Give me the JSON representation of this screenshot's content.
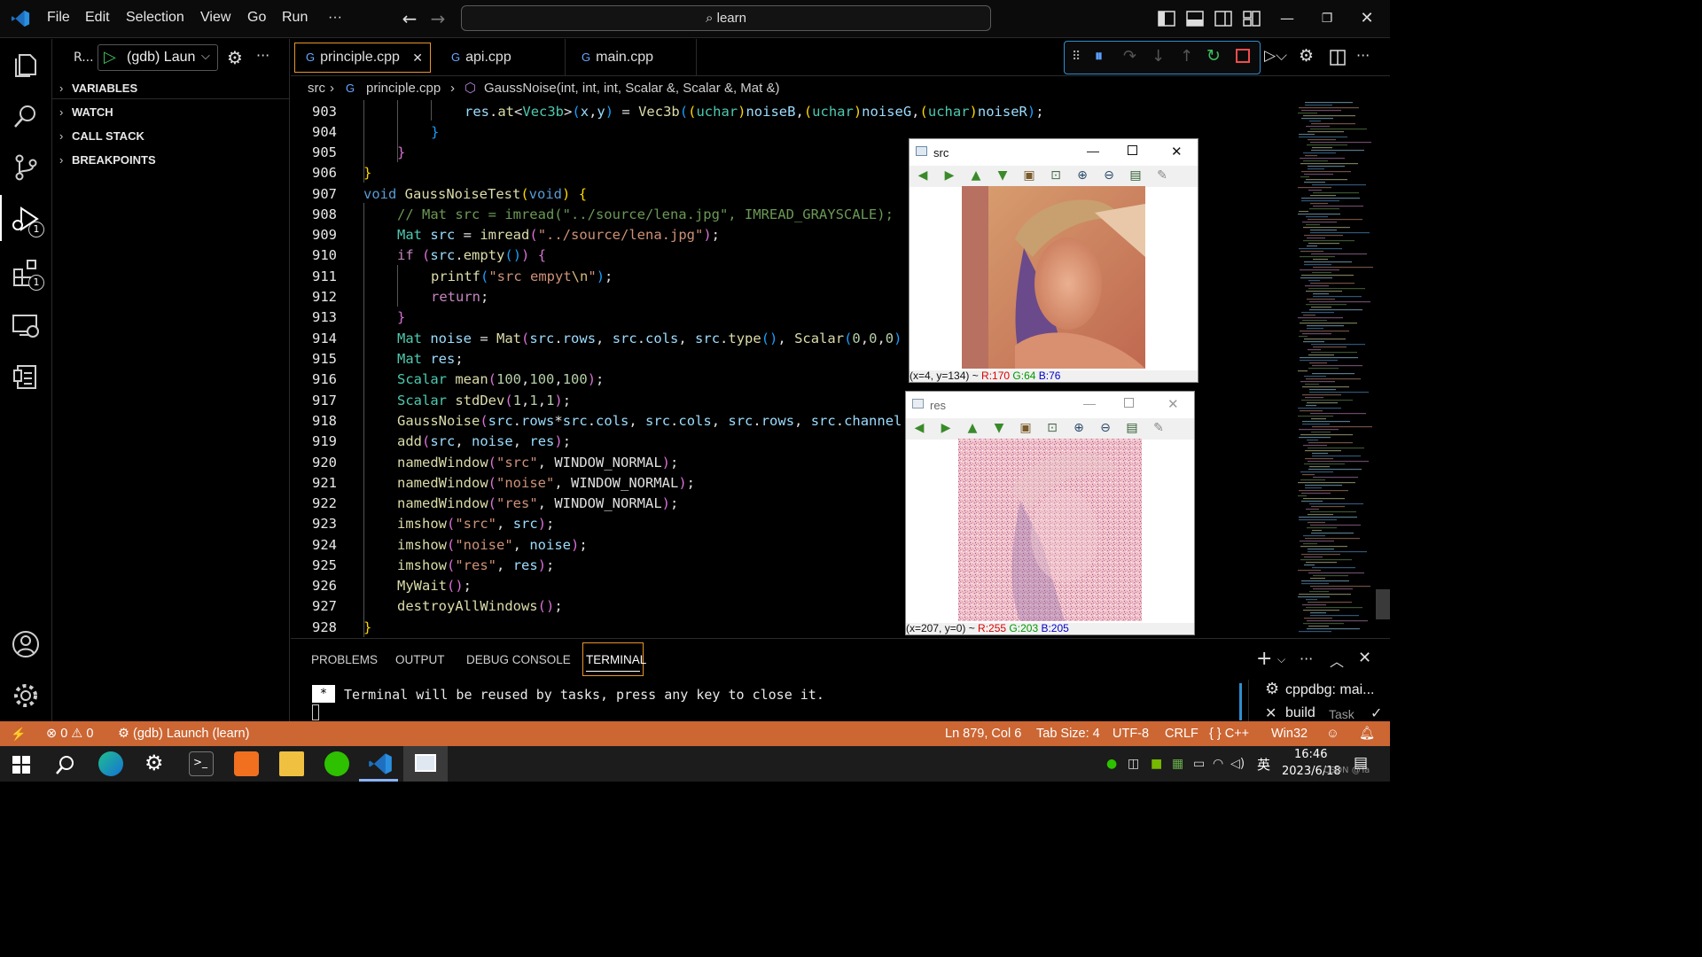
{
  "titlebar": {
    "menus": [
      "File",
      "Edit",
      "Selection",
      "View",
      "Go",
      "Run",
      "···"
    ],
    "search": "learn"
  },
  "activity": {
    "debug_badge": "1",
    "extensions_badge": "1"
  },
  "debug_toolbar": {
    "config_prefix": "R...",
    "config_name": "(gdb) Laun"
  },
  "sidebar": {
    "sections": [
      "VARIABLES",
      "WATCH",
      "CALL STACK",
      "BREAKPOINTS"
    ]
  },
  "tabs": [
    {
      "label": "principle.cpp",
      "active": true
    },
    {
      "label": "api.cpp",
      "active": false
    },
    {
      "label": "main.cpp",
      "active": false
    }
  ],
  "breadcrumbs": {
    "folder": "src",
    "file": "principle.cpp",
    "symbol": "GaussNoise(int, int, int, Scalar &, Scalar &, Mat &)"
  },
  "editor": {
    "line_numbers": [
      "903",
      "904",
      "905",
      "906",
      "907",
      "908",
      "909",
      "910",
      "911",
      "912",
      "913",
      "914",
      "915",
      "916",
      "917",
      "918",
      "919",
      "920",
      "921",
      "922",
      "923",
      "924",
      "925",
      "926",
      "927",
      "928"
    ]
  },
  "windows": {
    "src": {
      "title": "src",
      "status_prefix": "(x=4, y=134) ~ ",
      "r": "R:170",
      "g": "G:64",
      "b": "B:76"
    },
    "res": {
      "title": "res",
      "status_prefix": "(x=207, y=0) ~ ",
      "r": "R:255",
      "g": "G:203",
      "b": "B:205"
    }
  },
  "panel": {
    "tabs": [
      "PROBLEMS",
      "OUTPUT",
      "DEBUG CONSOLE",
      "TERMINAL"
    ],
    "active_tab": "TERMINAL",
    "terminal_text": "Terminal will be reused by tasks, press any key to close it.",
    "prompt_marker": "*",
    "tasks": [
      {
        "label": "cppdbg: mai...",
        "sub": ""
      },
      {
        "label": "build",
        "sub": "Task"
      }
    ]
  },
  "statusbar": {
    "errors": "0",
    "warnings": "0",
    "launch": "(gdb) Launch (learn)",
    "position": "Ln 879, Col 6",
    "tab_size": "Tab Size: 4",
    "encoding": "UTF-8",
    "eol": "CRLF",
    "language": "{ } C++",
    "platform": "Win32",
    "accent": "#cc6633"
  },
  "taskbar": {
    "time": "16:46",
    "date": "2023/6/18",
    "ime": "英",
    "watermark": "CSDN @Ta"
  }
}
